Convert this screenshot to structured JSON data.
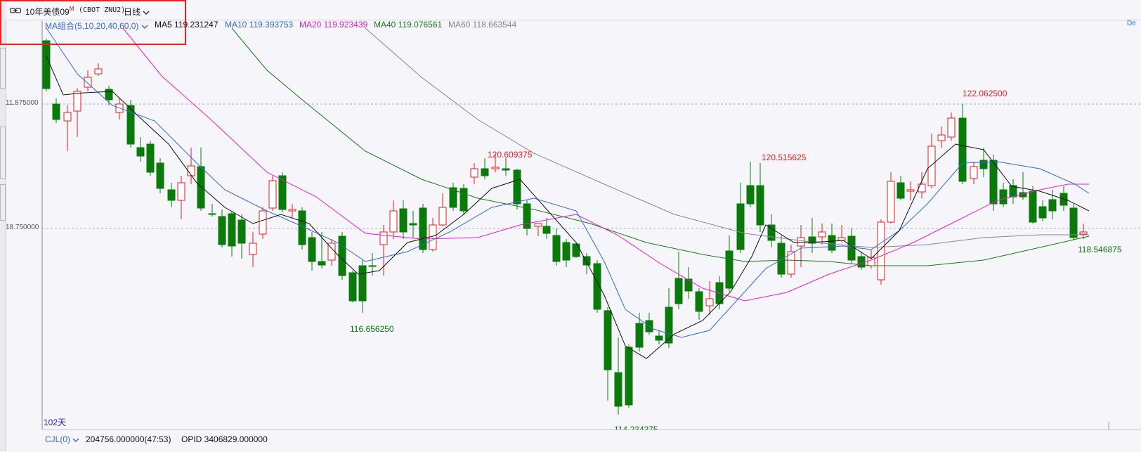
{
  "header": {
    "instrument_name": "10年美债09",
    "superscript": "M",
    "symbol": "(CBOT ZNU2)",
    "period": "日线"
  },
  "ma_indicator": {
    "group_label": "MA组合(5,10,20,40,60,0)",
    "ma5_label": "MA5 119.231247",
    "ma10_label": "MA10 119.393753",
    "ma20_label": "MA20 119.923439",
    "ma40_label": "MA40 119.076561",
    "ma60_label": "MA60 118.663544",
    "right_edge_text": "De",
    "colors": {
      "ma5": "#111111",
      "ma10": "#2e6bd8",
      "ma20": "#e020d0",
      "ma40": "#1a7a1a",
      "ma60": "#888888",
      "up": "#e81c1c",
      "down": "#0a7a0a"
    }
  },
  "axis": {
    "label_high": "11.875000",
    "label_low": "18.750000"
  },
  "annotations": {
    "high_1": "120.609375",
    "high_2": "120.515625",
    "high_3": "122.062500",
    "low_1": "116.656250",
    "low_2": "114.234375",
    "last_low": "118.546875"
  },
  "footer": {
    "days_label": "102天",
    "cjl_label": "CJL(0)",
    "volume_text": "204756.000000(47:53)",
    "opid_text": "OPID 3406829.000000"
  }
}
